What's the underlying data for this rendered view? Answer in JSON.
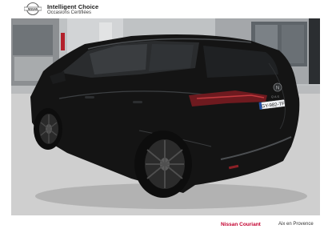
{
  "header": {
    "logo_text": "NISSAN",
    "title": "Intelligent Choice",
    "subtitle": "Occasions Certifiées"
  },
  "vehicle": {
    "plate": "GY-982-TF",
    "badge": "N",
    "model_badge": "Q A S"
  },
  "footer": {
    "dealer": "Nissan Couriant",
    "city": "Aix en Provence"
  },
  "colors": {
    "brand_red": "#c3002f",
    "car_body": "#121212",
    "background": "#ffffff"
  }
}
